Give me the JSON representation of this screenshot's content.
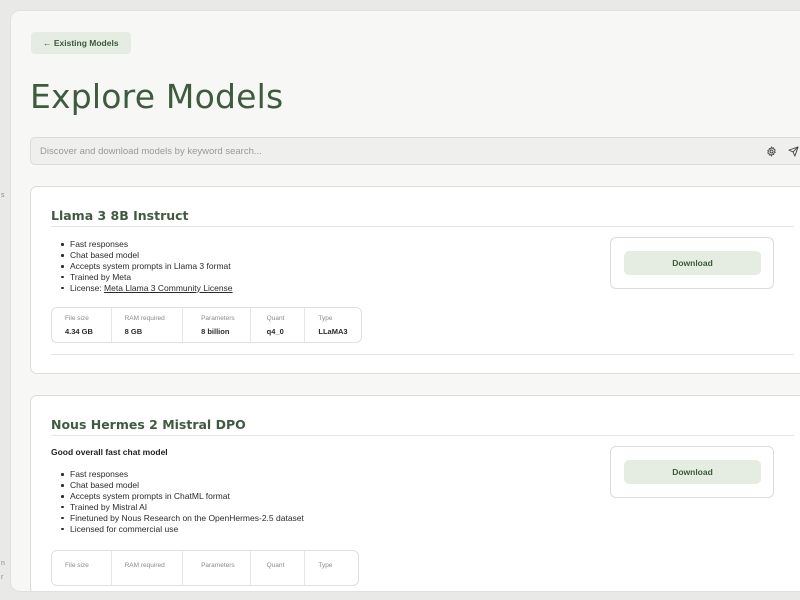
{
  "header": {
    "back_label": "← Existing Models",
    "title": "Explore Models"
  },
  "search": {
    "placeholder": "Discover and download models by keyword search...",
    "value": ""
  },
  "icons": {
    "settings": "gear-icon",
    "send": "send-icon"
  },
  "colors": {
    "accent_text": "#3d5c3d",
    "button_bg": "#e5ede2",
    "panel_bg": "#f7f7f6",
    "page_bg": "#e9eae8"
  },
  "models": [
    {
      "name": "Llama 3 8B Instruct",
      "subtitle": "",
      "features": [
        "Fast responses",
        "Chat based model",
        "Accepts system prompts in Llama 3 format",
        "Trained by Meta"
      ],
      "license_prefix": "License: ",
      "license_link": "Meta Llama 3 Community License",
      "download_label": "Download",
      "specs": [
        {
          "label": "File size",
          "value": "4.34 GB"
        },
        {
          "label": "RAM required",
          "value": "8 GB"
        },
        {
          "label": "Parameters",
          "value": "8 billion"
        },
        {
          "label": "Quant",
          "value": "q4_0"
        },
        {
          "label": "Type",
          "value": "LLaMA3"
        }
      ]
    },
    {
      "name": "Nous Hermes 2 Mistral DPO",
      "subtitle": "Good overall fast chat model",
      "features": [
        "Fast responses",
        "Chat based model",
        "Accepts system prompts in ChatML format",
        "Trained by Mistral AI",
        "Finetuned by Nous Research on the OpenHermes-2.5 dataset",
        "Licensed for commercial use"
      ],
      "download_label": "Download",
      "specs": [
        {
          "label": "File size",
          "value": ""
        },
        {
          "label": "RAM required",
          "value": ""
        },
        {
          "label": "Parameters",
          "value": ""
        },
        {
          "label": "Quant",
          "value": ""
        },
        {
          "label": "Type",
          "value": ""
        }
      ]
    }
  ]
}
